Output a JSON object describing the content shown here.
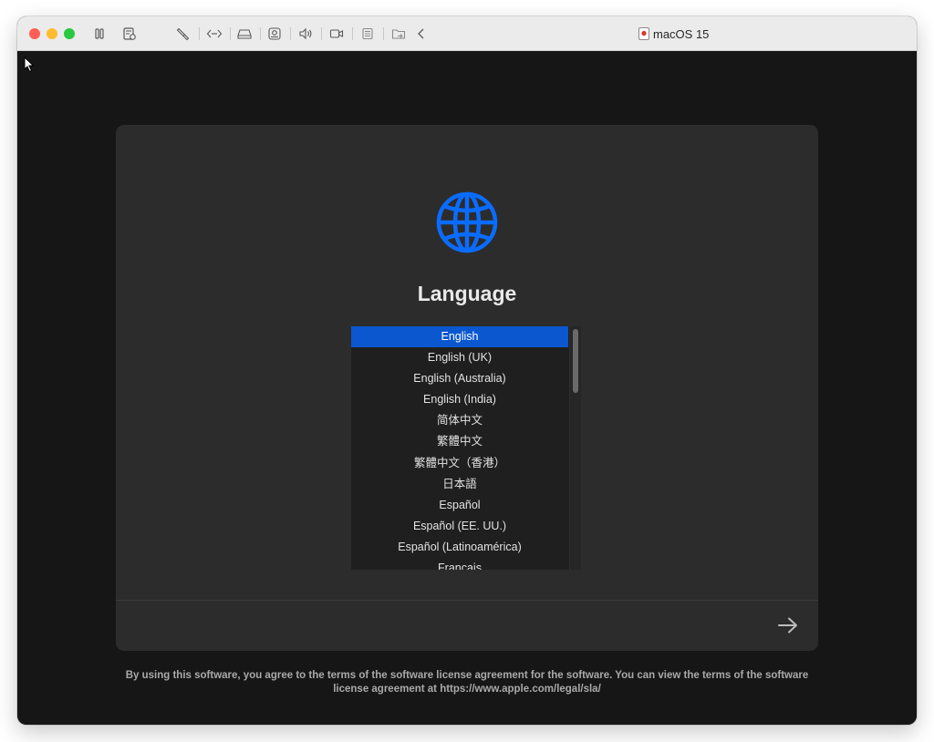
{
  "window": {
    "title": "macOS 15",
    "toolbar_icons": [
      "pause-icon",
      "snapshot-icon",
      "settings-wrench-icon",
      "network-icon",
      "disk-icon",
      "usb-camera-icon",
      "sound-icon",
      "video-icon",
      "clipboard-icon",
      "shared-folder-icon",
      "back-chevron-icon"
    ],
    "traffic_colors": {
      "close": "#ff5f57",
      "minimize": "#febc2e",
      "zoom": "#28c840"
    }
  },
  "setup": {
    "heading": "Language",
    "globe_color": "#0a6cff",
    "languages": [
      "English",
      "English (UK)",
      "English (Australia)",
      "English (India)",
      "简体中文",
      "繁體中文",
      "繁體中文（香港）",
      "日本語",
      "Español",
      "Español (EE. UU.)",
      "Español (Latinoamérica)",
      "Français"
    ],
    "selected_language": "English",
    "selection_color": "#0a57cf",
    "next_icon": "arrow-right-icon",
    "license_text": "By using this software, you agree to the terms of the software license agreement for the software. You can view the terms of the software license agreement at https://www.apple.com/legal/sla/"
  }
}
